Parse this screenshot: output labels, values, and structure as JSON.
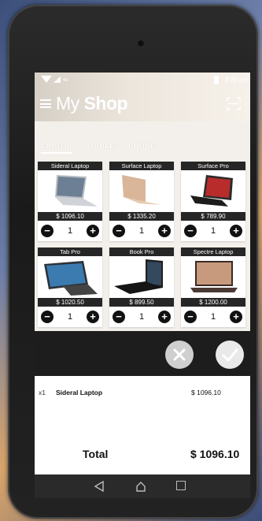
{
  "status": {
    "network": "4G",
    "time": "3:30 pm"
  },
  "header": {
    "title_thin": "My",
    "title_bold": "Shop"
  },
  "tabs": [
    {
      "label": "LAPTOP",
      "active": true
    },
    {
      "label": "TABLET",
      "active": false
    },
    {
      "label": "PHONE",
      "active": false
    }
  ],
  "products": [
    {
      "name": "Sideral Laptop",
      "price": "$ 1096.10",
      "qty": "1",
      "icon": "silver-laptop"
    },
    {
      "name": "Surface Laptop",
      "price": "$ 1335.20",
      "qty": "1",
      "icon": "gold-laptop"
    },
    {
      "name": "Surface Pro",
      "price": "$ 789.90",
      "qty": "1",
      "icon": "black-tablet"
    },
    {
      "name": "Tab Pro",
      "price": "$ 1020.50",
      "qty": "1",
      "icon": "convertible-laptop"
    },
    {
      "name": "Book Pro",
      "price": "$ 899.50",
      "qty": "1",
      "icon": "black-tablet-keyboard"
    },
    {
      "name": "Spectre Laptop",
      "price": "$ 1200.00",
      "qty": "1",
      "icon": "dark-laptop"
    }
  ],
  "cart": {
    "items": [
      {
        "qty": "x1",
        "name": "Sideral Laptop",
        "amount": "$ 1096.10"
      }
    ],
    "total_label": "Total",
    "total_value": "$ 1096.10"
  },
  "colors": {
    "header": "#e8e2d9",
    "card_bar": "#262626",
    "strip": "#1d1d1d",
    "navbar": "#2a2a2a"
  }
}
